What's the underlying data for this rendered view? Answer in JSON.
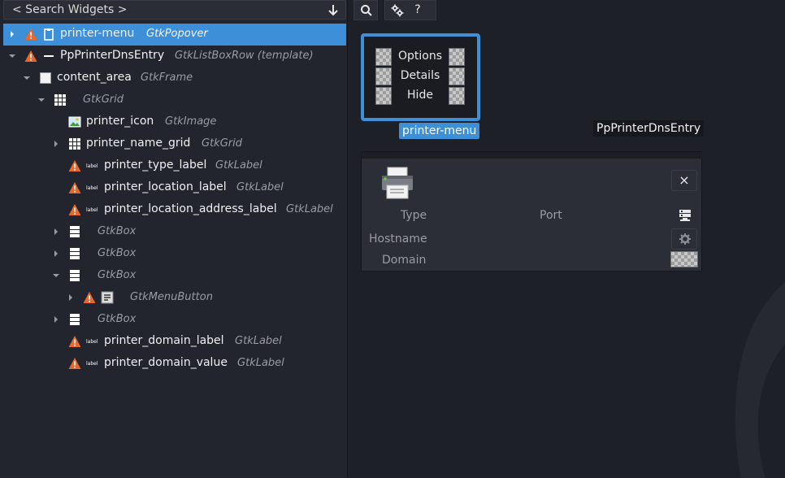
{
  "search": {
    "placeholder": "< Search Widgets >"
  },
  "tree": [
    {
      "name": "printer-menu",
      "type": "GtkPopover",
      "selected": true,
      "icon": "popover-icon",
      "warn": true,
      "expander": "collapsed"
    },
    {
      "name": "PpPrinterDnsEntry",
      "type": "GtkListBoxRow  (template)",
      "icon": "listboxrow-icon",
      "warn": true,
      "expander": "expanded"
    },
    {
      "name": "content_area",
      "type": "GtkFrame",
      "icon": "frame-icon",
      "expander": "expanded"
    },
    {
      "name": "",
      "type": "GtkGrid",
      "icon": "grid-icon",
      "expander": "expanded"
    },
    {
      "name": "printer_icon",
      "type": "GtkImage",
      "icon": "image-icon"
    },
    {
      "name": "printer_name_grid",
      "type": "GtkGrid",
      "icon": "grid-icon",
      "expander": "collapsed"
    },
    {
      "name": "printer_type_label",
      "type": "GtkLabel",
      "icon": "label-icon",
      "warn": true
    },
    {
      "name": "printer_location_label",
      "type": "GtkLabel",
      "icon": "label-icon",
      "warn": true
    },
    {
      "name": "printer_location_address_label",
      "type": "GtkLabel",
      "icon": "label-icon",
      "warn": true
    },
    {
      "name": "",
      "type": "GtkBox",
      "icon": "box-icon",
      "expander": "collapsed"
    },
    {
      "name": "",
      "type": "GtkBox",
      "icon": "box-icon",
      "expander": "collapsed"
    },
    {
      "name": "",
      "type": "GtkBox",
      "icon": "box-icon",
      "expander": "expanded"
    },
    {
      "name": "",
      "type": "GtkMenuButton",
      "icon": "menubutton-icon",
      "warn": true,
      "expander": "collapsed"
    },
    {
      "name": "",
      "type": "GtkBox",
      "icon": "box-icon",
      "expander": "collapsed"
    },
    {
      "name": "printer_domain_label",
      "type": "GtkLabel",
      "icon": "label-icon",
      "warn": true
    },
    {
      "name": "printer_domain_value",
      "type": "GtkLabel",
      "icon": "label-icon",
      "warn": true
    }
  ],
  "toolbar": {
    "search_icon": "search-icon",
    "settings_icon": "gear-icon",
    "help_label": "?"
  },
  "popover": {
    "items": [
      "Options",
      "Details",
      "Hide"
    ],
    "tag": "printer-menu"
  },
  "row_preview": {
    "type_label": "Type",
    "port_label": "Port",
    "hostname_label": "Hostname",
    "domain_label": "Domain",
    "close_label": "×",
    "tag": "PpPrinterDnsEntry"
  },
  "colors": {
    "accent": "#3d8fd8",
    "warning": "#e8672a",
    "background": "#1e2028"
  }
}
